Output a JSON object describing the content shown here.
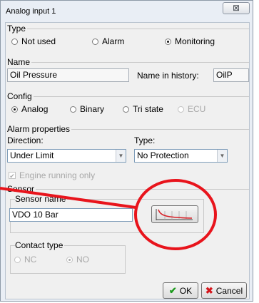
{
  "window": {
    "title": "Analog input 1",
    "close_glyph": "⊠"
  },
  "type_group": {
    "title": "Type",
    "options": [
      {
        "label": "Not used",
        "selected": false
      },
      {
        "label": "Alarm",
        "selected": false
      },
      {
        "label": "Monitoring",
        "selected": true
      }
    ]
  },
  "name_group": {
    "title": "Name",
    "name_value": "Oil Pressure",
    "history_label": "Name in history:",
    "history_value": "OilP"
  },
  "config_group": {
    "title": "Config",
    "options": [
      {
        "label": "Analog",
        "selected": true,
        "enabled": true
      },
      {
        "label": "Binary",
        "selected": false,
        "enabled": true
      },
      {
        "label": "Tri state",
        "selected": false,
        "enabled": true
      },
      {
        "label": "ECU",
        "selected": false,
        "enabled": false
      }
    ]
  },
  "alarm_group": {
    "title": "Alarm properties",
    "direction_label": "Direction:",
    "direction_value": "Under Limit",
    "type_label": "Type:",
    "type_value": "No Protection",
    "engine_check_label": "Engine running only",
    "engine_check_checked": true,
    "engine_check_enabled": false
  },
  "sensor_group": {
    "title": "Sensor",
    "sensor_name_title": "Sensor name",
    "sensor_name_value": "VDO 10 Bar",
    "contact_title": "Contact type",
    "contact_options": [
      {
        "label": "NC",
        "selected": false
      },
      {
        "label": "NO",
        "selected": true
      }
    ]
  },
  "buttons": {
    "ok": "OK",
    "cancel": "Cancel"
  },
  "annotation": {
    "color": "#e8141c"
  },
  "colors": {
    "window_border": "#8e9aa8",
    "ok_check": "#1c9a1c",
    "cancel_x": "#d4161c",
    "curve": "#d8232a"
  }
}
